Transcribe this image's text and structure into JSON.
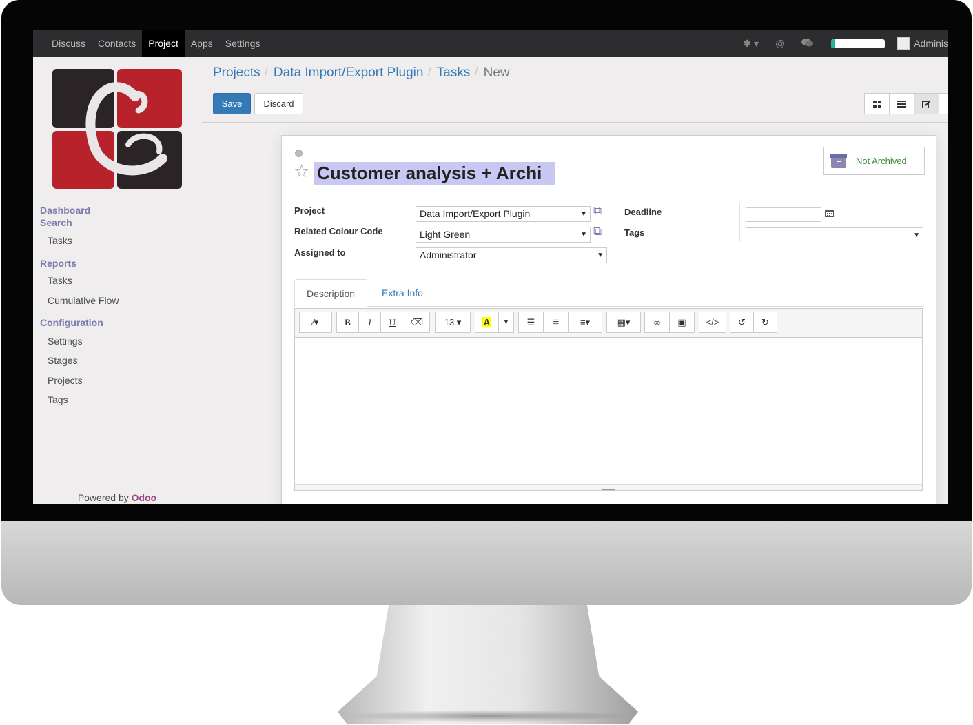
{
  "navbar": {
    "menu": [
      "Discuss",
      "Contacts",
      "Project",
      "Apps",
      "Settings"
    ],
    "active_menu": "Project",
    "user_name": "Adminis",
    "progress": 0.08
  },
  "sidebar": {
    "sections": [
      {
        "label": "Dashboard\nSearch",
        "items": [
          "Tasks"
        ]
      },
      {
        "label": "Reports",
        "items": [
          "Tasks",
          "Cumulative Flow"
        ]
      },
      {
        "label": "Configuration",
        "items": [
          "Settings",
          "Stages",
          "Projects",
          "Tags"
        ]
      }
    ],
    "dashboard": "Dashboard",
    "search": "Search",
    "search_tasks": "Tasks",
    "reports": "Reports",
    "reports_tasks": "Tasks",
    "cumulative_flow": "Cumulative Flow",
    "configuration": "Configuration",
    "config_settings": "Settings",
    "config_stages": "Stages",
    "config_projects": "Projects",
    "config_tags": "Tags",
    "powered_by": "Powered by",
    "odoo": "Odoo"
  },
  "breadcrumb": {
    "projects": "Projects",
    "project": "Data Import/Export Plugin",
    "tasks": "Tasks",
    "current": "New"
  },
  "buttons": {
    "save": "Save",
    "discard": "Discard"
  },
  "form": {
    "title_value": "Customer analysis + Archi",
    "archive_label": "Not Archived",
    "project_label": "Project",
    "project_value": "Data Import/Export Plugin",
    "colour_label": "Related Colour Code",
    "colour_value": "Light Green",
    "assigned_label": "Assigned to",
    "assigned_value": "Administrator",
    "deadline_label": "Deadline",
    "deadline_value": "",
    "tags_label": "Tags",
    "tags_value": ""
  },
  "tabs": {
    "description": "Description",
    "extra_info": "Extra Info"
  },
  "editor": {
    "font_size": "13"
  },
  "colors": {
    "primary": "#337ab7",
    "sidebar_accent": "#7c7bad",
    "navbar": "#2d2d2f",
    "archived_green": "#3d8c3d",
    "odoo": "#a24689"
  }
}
